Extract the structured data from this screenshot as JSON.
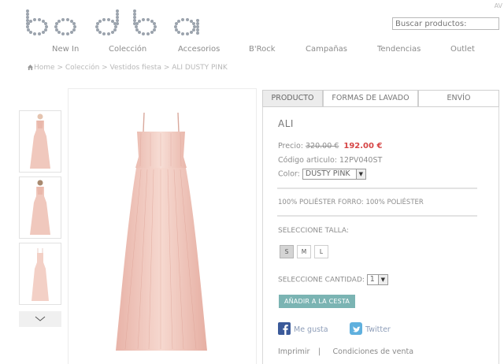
{
  "header": {
    "logo_text": "bdba",
    "corner_text": "AV",
    "search_placeholder": "Buscar productos:"
  },
  "nav": {
    "items": [
      "New In",
      "Colección",
      "Accesorios",
      "B'Rock",
      "Campañas",
      "Tendencias",
      "Outlet"
    ]
  },
  "breadcrumb": {
    "home": "Home",
    "separator": " > ",
    "items": [
      "Colección",
      "Vestidos fiesta",
      "ALI DUSTY PINK"
    ]
  },
  "gallery": {
    "thumb_count": 3,
    "more_icon": "chevron-down-icon",
    "dress_color": "#f2c9bf"
  },
  "tabs": [
    "PRODUCTO",
    "FORMAS DE LAVADO",
    "ENVÍO"
  ],
  "product": {
    "name": "ALI",
    "price_label": "Precio:",
    "old_price": "320.00 €",
    "new_price": "192.00 €",
    "code_label": "Código articulo:",
    "code": "12PV040ST",
    "color_label": "Color:",
    "color_value": "DUSTY PINK",
    "composition": "100% POLIÉSTER FORRO: 100% POLIÉSTER",
    "size_label": "SELECCIONE TALLA:",
    "sizes": [
      "S",
      "M",
      "L"
    ],
    "selected_size": "S",
    "qty_label": "SELECCIONE CANTIDAD:",
    "qty_value": "1",
    "add_to_cart": "AÑADIR A LA CESTA"
  },
  "social": {
    "facebook": "Me gusta",
    "twitter": "Twitter"
  },
  "footer_links": {
    "print": "Imprimir",
    "separator": "|",
    "conditions": "Condiciones de venta"
  },
  "colors": {
    "accent": "#7bb4b3",
    "sale_price": "#d64545"
  }
}
